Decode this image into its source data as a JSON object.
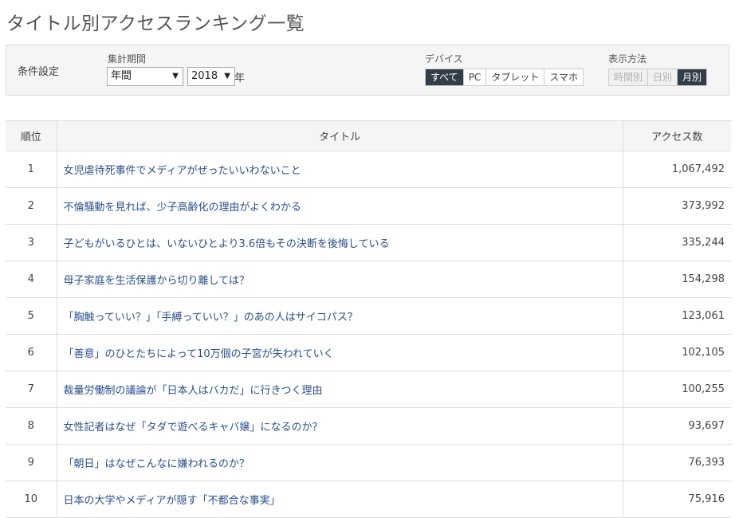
{
  "page_title": "タイトル別アクセスランキング一覧",
  "settings": {
    "label": "条件設定",
    "period": {
      "label": "集計期間",
      "type_value": "年間",
      "year_value": "2018",
      "year_suffix": "年"
    },
    "device": {
      "label": "デバイス",
      "options": [
        "すべて",
        "PC",
        "タブレット",
        "スマホ"
      ],
      "selected": "すべて"
    },
    "display": {
      "label": "表示方法",
      "options": [
        "時間別",
        "日別",
        "月別"
      ],
      "selected": "月別"
    }
  },
  "table": {
    "headers": [
      "順位",
      "タイトル",
      "アクセス数"
    ],
    "rows": [
      {
        "rank": "1",
        "title": "女児虐待死事件でメディアがぜったいいわないこと",
        "count": "1,067,492"
      },
      {
        "rank": "2",
        "title": "不倫騒動を見れば、少子高齢化の理由がよくわかる",
        "count": "373,992"
      },
      {
        "rank": "3",
        "title": "子どもがいるひとは、いないひとより3.6倍もその決断を後悔している",
        "count": "335,244"
      },
      {
        "rank": "4",
        "title": "母子家庭を生活保護から切り離しては？",
        "count": "154,298"
      },
      {
        "rank": "5",
        "title": "「胸触っていい？」「手縛っていい？」のあの人はサイコパス？",
        "count": "123,061"
      },
      {
        "rank": "6",
        "title": "「善意」のひとたちによって10万個の子宮が失われていく",
        "count": "102,105"
      },
      {
        "rank": "7",
        "title": "裁量労働制の議論が「日本人はバカだ」に行きつく理由",
        "count": "100,255"
      },
      {
        "rank": "8",
        "title": "女性記者はなぜ「タダで遊べるキャバ嬢」になるのか？",
        "count": "93,697"
      },
      {
        "rank": "9",
        "title": "「朝日」はなぜこんなに嫌われるのか？",
        "count": "76,393"
      },
      {
        "rank": "10",
        "title": "日本の大学やメディアが隠す「不都合な事実」",
        "count": "75,916"
      }
    ]
  },
  "colors": {
    "active_button": "#333d47",
    "link": "#2a4f8f",
    "panel_bg": "#f5f5f5"
  },
  "icons": {
    "select_arrow": "caret-down-icon"
  }
}
